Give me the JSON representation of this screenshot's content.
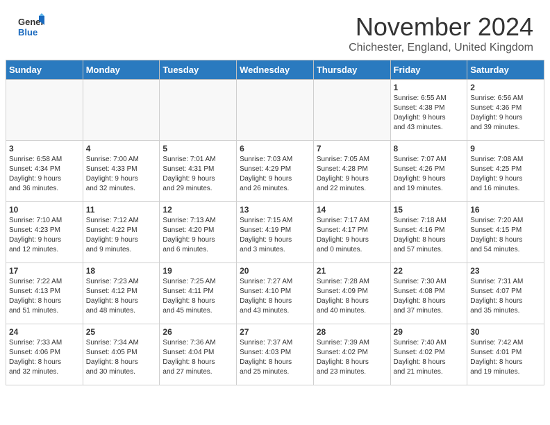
{
  "header": {
    "logo_general": "General",
    "logo_blue": "Blue",
    "month_title": "November 2024",
    "location": "Chichester, England, United Kingdom"
  },
  "days_of_week": [
    "Sunday",
    "Monday",
    "Tuesday",
    "Wednesday",
    "Thursday",
    "Friday",
    "Saturday"
  ],
  "weeks": [
    [
      {
        "num": "",
        "info": ""
      },
      {
        "num": "",
        "info": ""
      },
      {
        "num": "",
        "info": ""
      },
      {
        "num": "",
        "info": ""
      },
      {
        "num": "",
        "info": ""
      },
      {
        "num": "1",
        "info": "Sunrise: 6:55 AM\nSunset: 4:38 PM\nDaylight: 9 hours\nand 43 minutes."
      },
      {
        "num": "2",
        "info": "Sunrise: 6:56 AM\nSunset: 4:36 PM\nDaylight: 9 hours\nand 39 minutes."
      }
    ],
    [
      {
        "num": "3",
        "info": "Sunrise: 6:58 AM\nSunset: 4:34 PM\nDaylight: 9 hours\nand 36 minutes."
      },
      {
        "num": "4",
        "info": "Sunrise: 7:00 AM\nSunset: 4:33 PM\nDaylight: 9 hours\nand 32 minutes."
      },
      {
        "num": "5",
        "info": "Sunrise: 7:01 AM\nSunset: 4:31 PM\nDaylight: 9 hours\nand 29 minutes."
      },
      {
        "num": "6",
        "info": "Sunrise: 7:03 AM\nSunset: 4:29 PM\nDaylight: 9 hours\nand 26 minutes."
      },
      {
        "num": "7",
        "info": "Sunrise: 7:05 AM\nSunset: 4:28 PM\nDaylight: 9 hours\nand 22 minutes."
      },
      {
        "num": "8",
        "info": "Sunrise: 7:07 AM\nSunset: 4:26 PM\nDaylight: 9 hours\nand 19 minutes."
      },
      {
        "num": "9",
        "info": "Sunrise: 7:08 AM\nSunset: 4:25 PM\nDaylight: 9 hours\nand 16 minutes."
      }
    ],
    [
      {
        "num": "10",
        "info": "Sunrise: 7:10 AM\nSunset: 4:23 PM\nDaylight: 9 hours\nand 12 minutes."
      },
      {
        "num": "11",
        "info": "Sunrise: 7:12 AM\nSunset: 4:22 PM\nDaylight: 9 hours\nand 9 minutes."
      },
      {
        "num": "12",
        "info": "Sunrise: 7:13 AM\nSunset: 4:20 PM\nDaylight: 9 hours\nand 6 minutes."
      },
      {
        "num": "13",
        "info": "Sunrise: 7:15 AM\nSunset: 4:19 PM\nDaylight: 9 hours\nand 3 minutes."
      },
      {
        "num": "14",
        "info": "Sunrise: 7:17 AM\nSunset: 4:17 PM\nDaylight: 9 hours\nand 0 minutes."
      },
      {
        "num": "15",
        "info": "Sunrise: 7:18 AM\nSunset: 4:16 PM\nDaylight: 8 hours\nand 57 minutes."
      },
      {
        "num": "16",
        "info": "Sunrise: 7:20 AM\nSunset: 4:15 PM\nDaylight: 8 hours\nand 54 minutes."
      }
    ],
    [
      {
        "num": "17",
        "info": "Sunrise: 7:22 AM\nSunset: 4:13 PM\nDaylight: 8 hours\nand 51 minutes."
      },
      {
        "num": "18",
        "info": "Sunrise: 7:23 AM\nSunset: 4:12 PM\nDaylight: 8 hours\nand 48 minutes."
      },
      {
        "num": "19",
        "info": "Sunrise: 7:25 AM\nSunset: 4:11 PM\nDaylight: 8 hours\nand 45 minutes."
      },
      {
        "num": "20",
        "info": "Sunrise: 7:27 AM\nSunset: 4:10 PM\nDaylight: 8 hours\nand 43 minutes."
      },
      {
        "num": "21",
        "info": "Sunrise: 7:28 AM\nSunset: 4:09 PM\nDaylight: 8 hours\nand 40 minutes."
      },
      {
        "num": "22",
        "info": "Sunrise: 7:30 AM\nSunset: 4:08 PM\nDaylight: 8 hours\nand 37 minutes."
      },
      {
        "num": "23",
        "info": "Sunrise: 7:31 AM\nSunset: 4:07 PM\nDaylight: 8 hours\nand 35 minutes."
      }
    ],
    [
      {
        "num": "24",
        "info": "Sunrise: 7:33 AM\nSunset: 4:06 PM\nDaylight: 8 hours\nand 32 minutes."
      },
      {
        "num": "25",
        "info": "Sunrise: 7:34 AM\nSunset: 4:05 PM\nDaylight: 8 hours\nand 30 minutes."
      },
      {
        "num": "26",
        "info": "Sunrise: 7:36 AM\nSunset: 4:04 PM\nDaylight: 8 hours\nand 27 minutes."
      },
      {
        "num": "27",
        "info": "Sunrise: 7:37 AM\nSunset: 4:03 PM\nDaylight: 8 hours\nand 25 minutes."
      },
      {
        "num": "28",
        "info": "Sunrise: 7:39 AM\nSunset: 4:02 PM\nDaylight: 8 hours\nand 23 minutes."
      },
      {
        "num": "29",
        "info": "Sunrise: 7:40 AM\nSunset: 4:02 PM\nDaylight: 8 hours\nand 21 minutes."
      },
      {
        "num": "30",
        "info": "Sunrise: 7:42 AM\nSunset: 4:01 PM\nDaylight: 8 hours\nand 19 minutes."
      }
    ]
  ]
}
